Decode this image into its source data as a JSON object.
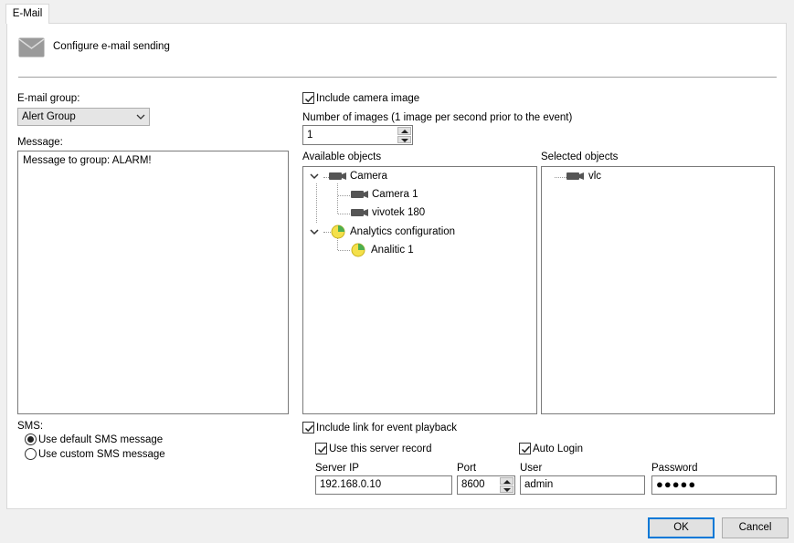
{
  "tab": {
    "label": "E-Mail"
  },
  "header": {
    "title": "Configure e-mail sending"
  },
  "email_group": {
    "label": "E-mail group:",
    "selected": "Alert Group"
  },
  "message": {
    "label": "Message:",
    "value": "Message to group: ALARM!"
  },
  "sms": {
    "label": "SMS:",
    "options": [
      {
        "label": "Use default SMS message",
        "selected": true
      },
      {
        "label": "Use custom SMS message",
        "selected": false
      }
    ]
  },
  "camera_image": {
    "checkbox_label": "Include camera image",
    "checked": true,
    "num_images_label": "Number of images (1 image per second prior to the event)",
    "num_images_value": "1"
  },
  "available_objects": {
    "label": "Available objects",
    "tree": [
      {
        "label": "Camera",
        "icon": "camera-icon",
        "expanded": true
      },
      {
        "label": "Camera 1",
        "icon": "camera-icon"
      },
      {
        "label": "vivotek 180",
        "icon": "camera-icon"
      },
      {
        "label": "Analytics configuration",
        "icon": "analytics-icon",
        "expanded": true
      },
      {
        "label": "Analitic 1",
        "icon": "analytics-icon"
      }
    ]
  },
  "selected_objects": {
    "label": "Selected objects",
    "items": [
      {
        "label": "vlc",
        "icon": "camera-icon"
      }
    ]
  },
  "playback": {
    "checkbox_label": "Include link for event playback",
    "checked": true,
    "use_server_record_label": "Use this server record",
    "use_server_record_checked": true,
    "auto_login_label": "Auto Login",
    "auto_login_checked": true,
    "server_ip_label": "Server IP",
    "server_ip_value": "192.168.0.10",
    "port_label": "Port",
    "port_value": "8600",
    "user_label": "User",
    "user_value": "admin",
    "password_label": "Password",
    "password_value": "●●●●●"
  },
  "footer": {
    "ok_label": "OK",
    "cancel_label": "Cancel"
  }
}
